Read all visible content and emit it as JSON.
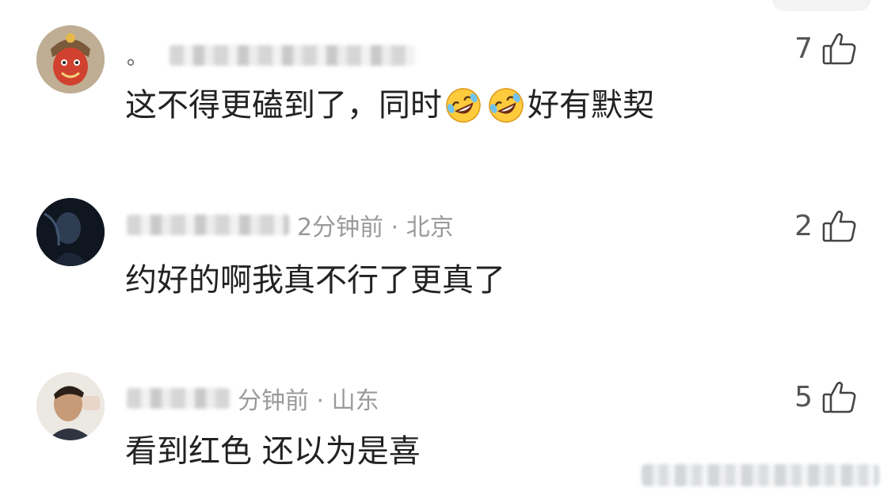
{
  "comments": [
    {
      "meta_prefix": "。",
      "meta_text": "",
      "content_before": "这不得更磕到了，同时",
      "emojis": [
        "rolling-on-floor-laughing",
        "rolling-on-floor-laughing"
      ],
      "content_after": "好有默契",
      "likes": "7"
    },
    {
      "meta_prefix": "",
      "meta_text": "2分钟前 · 北京",
      "content_before": "约好的啊我真不行了更真了",
      "emojis": [],
      "content_after": "",
      "likes": "2"
    },
    {
      "meta_prefix": "",
      "meta_text": "分钟前 · 山东",
      "content_before": "看到红色 还以为是喜",
      "emojis": [],
      "content_after": "",
      "likes": "5"
    }
  ],
  "icons": {
    "like": "thumbs-up-icon",
    "emoji": "rolling-on-floor-laughing"
  },
  "colors": {
    "text": "#222222",
    "meta": "#9a9a9a",
    "like_count": "#555555"
  }
}
